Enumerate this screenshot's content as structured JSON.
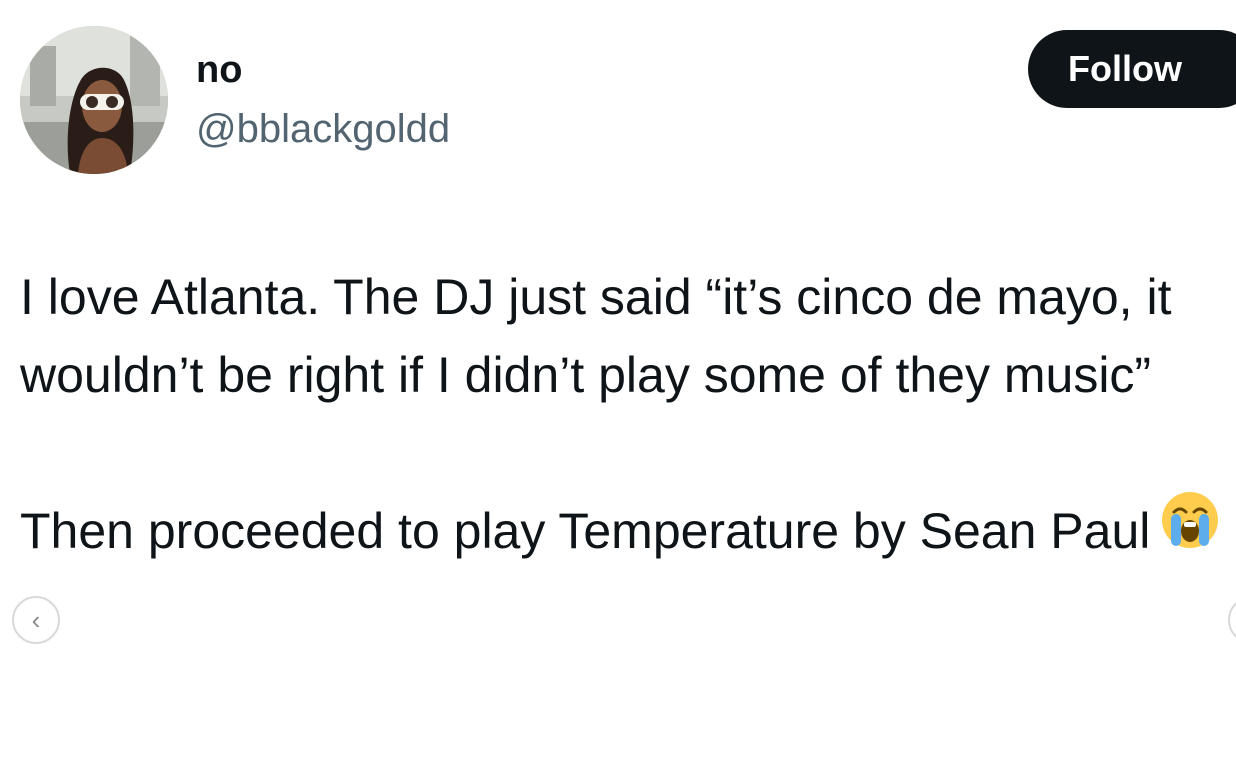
{
  "tweet": {
    "author": {
      "display_name": "no",
      "handle": "@bblackgoldd"
    },
    "follow_label": "Follow",
    "paragraphs": [
      "I love Atlanta. The DJ just said “it’s cinco de mayo, it wouldn’t be right if I didn’t play some of they music”",
      "Then proceeded to play Temperature by Sean Paul"
    ],
    "emoji": "loudly-crying-face"
  },
  "carousel": {
    "prev_icon": "chevron-left-icon",
    "next_icon": "chevron-right-icon"
  },
  "colors": {
    "text": "#0f1419",
    "secondary_text": "#536471",
    "follow_bg": "#0f1419",
    "follow_text": "#ffffff"
  }
}
